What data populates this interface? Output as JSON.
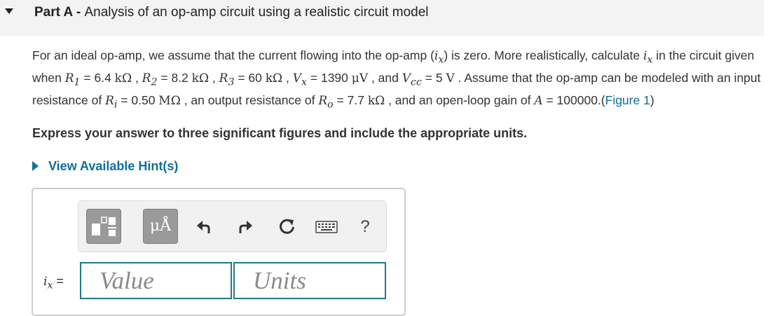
{
  "part": {
    "label": "Part A",
    "separator": " - ",
    "title": "Analysis of an op-amp circuit using a realistic circuit model"
  },
  "question": {
    "t1": "For an ideal op-amp, we assume that the current flowing into the op-amp (",
    "ix": "i",
    "ix_sub": "x",
    "t2": ") is zero. More realistically, calculate ",
    "t3": " in the circuit given when ",
    "R1_sub": "1",
    "R1_val": " = 6.4 ",
    "R2_sub": "2",
    "R2_val": " = 8.2 ",
    "R3_sub": "3",
    "R3_val": " = 60 ",
    "Vx_sub": "x",
    "Vx_val": " = 1390 ",
    "cc_sub": "cc",
    "Vcc_val": " = 5 ",
    "t4": " . Assume that the op-amp can be modeled with an input resistance of ",
    "Ri_sub": "i",
    "Ri_val": " = 0.50 ",
    "t5": " , an output resistance of ",
    "Ro_sub": "o",
    "Ro_val": " = 7.7 ",
    "t6": " , and an open-loop  gain of ",
    "A_val": " = 100000.",
    "figure_link": "Figure 1",
    "and_text": " , and ",
    "comma": " , ",
    "open_paren": "(",
    "close_paren": ")",
    "R": "R",
    "V": "V",
    "A": "A",
    "kohm": "kΩ",
    "mohm": "MΩ",
    "uV": "μV",
    "unit_V": "V"
  },
  "instruction": "Express your answer to three significant figures and include the appropriate units.",
  "hint_link": "View Available Hint(s)",
  "toolbar": {
    "units_label": "μÅ",
    "help_label": "?",
    "icons": [
      "templates-icon",
      "units-icon",
      "undo-icon",
      "redo-icon",
      "reset-icon",
      "keyboard-icon",
      "help-icon"
    ]
  },
  "answer": {
    "var": "i",
    "var_sub": "x",
    "equals": " =",
    "value_placeholder": "Value",
    "units_placeholder": "Units"
  },
  "colors": {
    "link": "#0f6f9a",
    "field_border": "#1f7a8c",
    "header_bg": "#f3f3f3",
    "tool_button": "#9a9a9a"
  }
}
